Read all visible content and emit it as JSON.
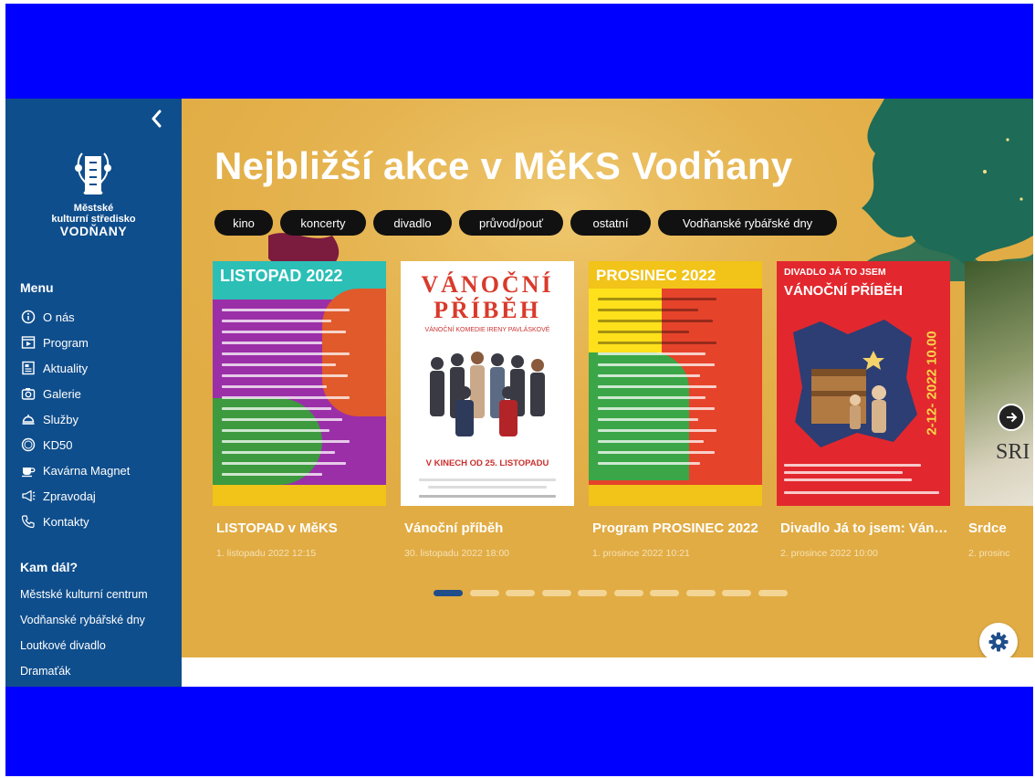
{
  "sidebar": {
    "logo_line1": "Městské",
    "logo_line2": "kulturní středisko",
    "logo_line3": "VODŇANY",
    "menu_heading": "Menu",
    "menu_items": [
      {
        "label": "O nás",
        "icon": "info-icon"
      },
      {
        "label": "Program",
        "icon": "calendar-play-icon"
      },
      {
        "label": "Aktuality",
        "icon": "news-icon"
      },
      {
        "label": "Galerie",
        "icon": "camera-icon"
      },
      {
        "label": "Služby",
        "icon": "service-bell-icon"
      },
      {
        "label": "KD50",
        "icon": "kd50-icon"
      },
      {
        "label": "Kavárna Magnet",
        "icon": "coffee-icon"
      },
      {
        "label": "Zpravodaj",
        "icon": "megaphone-icon"
      },
      {
        "label": "Kontakty",
        "icon": "phone-icon"
      }
    ],
    "links_heading": "Kam dál?",
    "links": [
      "Městské kulturní centrum",
      "Vodňanské rybářské dny",
      "Loutkové divadlo",
      "Dramaťák"
    ]
  },
  "main": {
    "heading": "Nejbližší akce v MěKS Vodňany",
    "filters": [
      "kino",
      "koncerty",
      "divadlo",
      "průvod/pouť",
      "ostatní",
      "Vodňanské rybářské dny"
    ],
    "events": [
      {
        "title": "LISTOPAD v MěKS",
        "date": "1. listopadu 2022 12:15",
        "poster_title": "LISTOPAD 2022"
      },
      {
        "title": "Vánoční příběh",
        "date": "30. listopadu 2022 18:00",
        "poster_title": "VÁNOČNÍ PŘÍBĚH",
        "poster_sub": "VÁNOČNÍ KOMEDIE IRENY PAVLÁSKOVÉ",
        "poster_footer": "V KINECH OD 25. LISTOPADU"
      },
      {
        "title": "Program PROSINEC 2022",
        "date": "1. prosince 2022 10:21",
        "poster_title": "PROSINEC 2022"
      },
      {
        "title": "Divadlo Já to jsem: Vánoční příběh",
        "date": "2. prosince 2022 10:00",
        "poster_title": "DIVADLO JÁ TO JSEM",
        "poster_sub": "VÁNOČNÍ PŘÍBĚH",
        "poster_side": "2-12- 2022 10.00"
      },
      {
        "title": "Srdce",
        "date": "2. prosinc",
        "poster_title": "SRI"
      }
    ],
    "carousel_pages": 10,
    "carousel_active": 0
  },
  "colors": {
    "sidebar": "#0f4e8c",
    "banner": "#e1ac44",
    "frame": "#0000ff",
    "dot_active": "#1f4e8a"
  }
}
